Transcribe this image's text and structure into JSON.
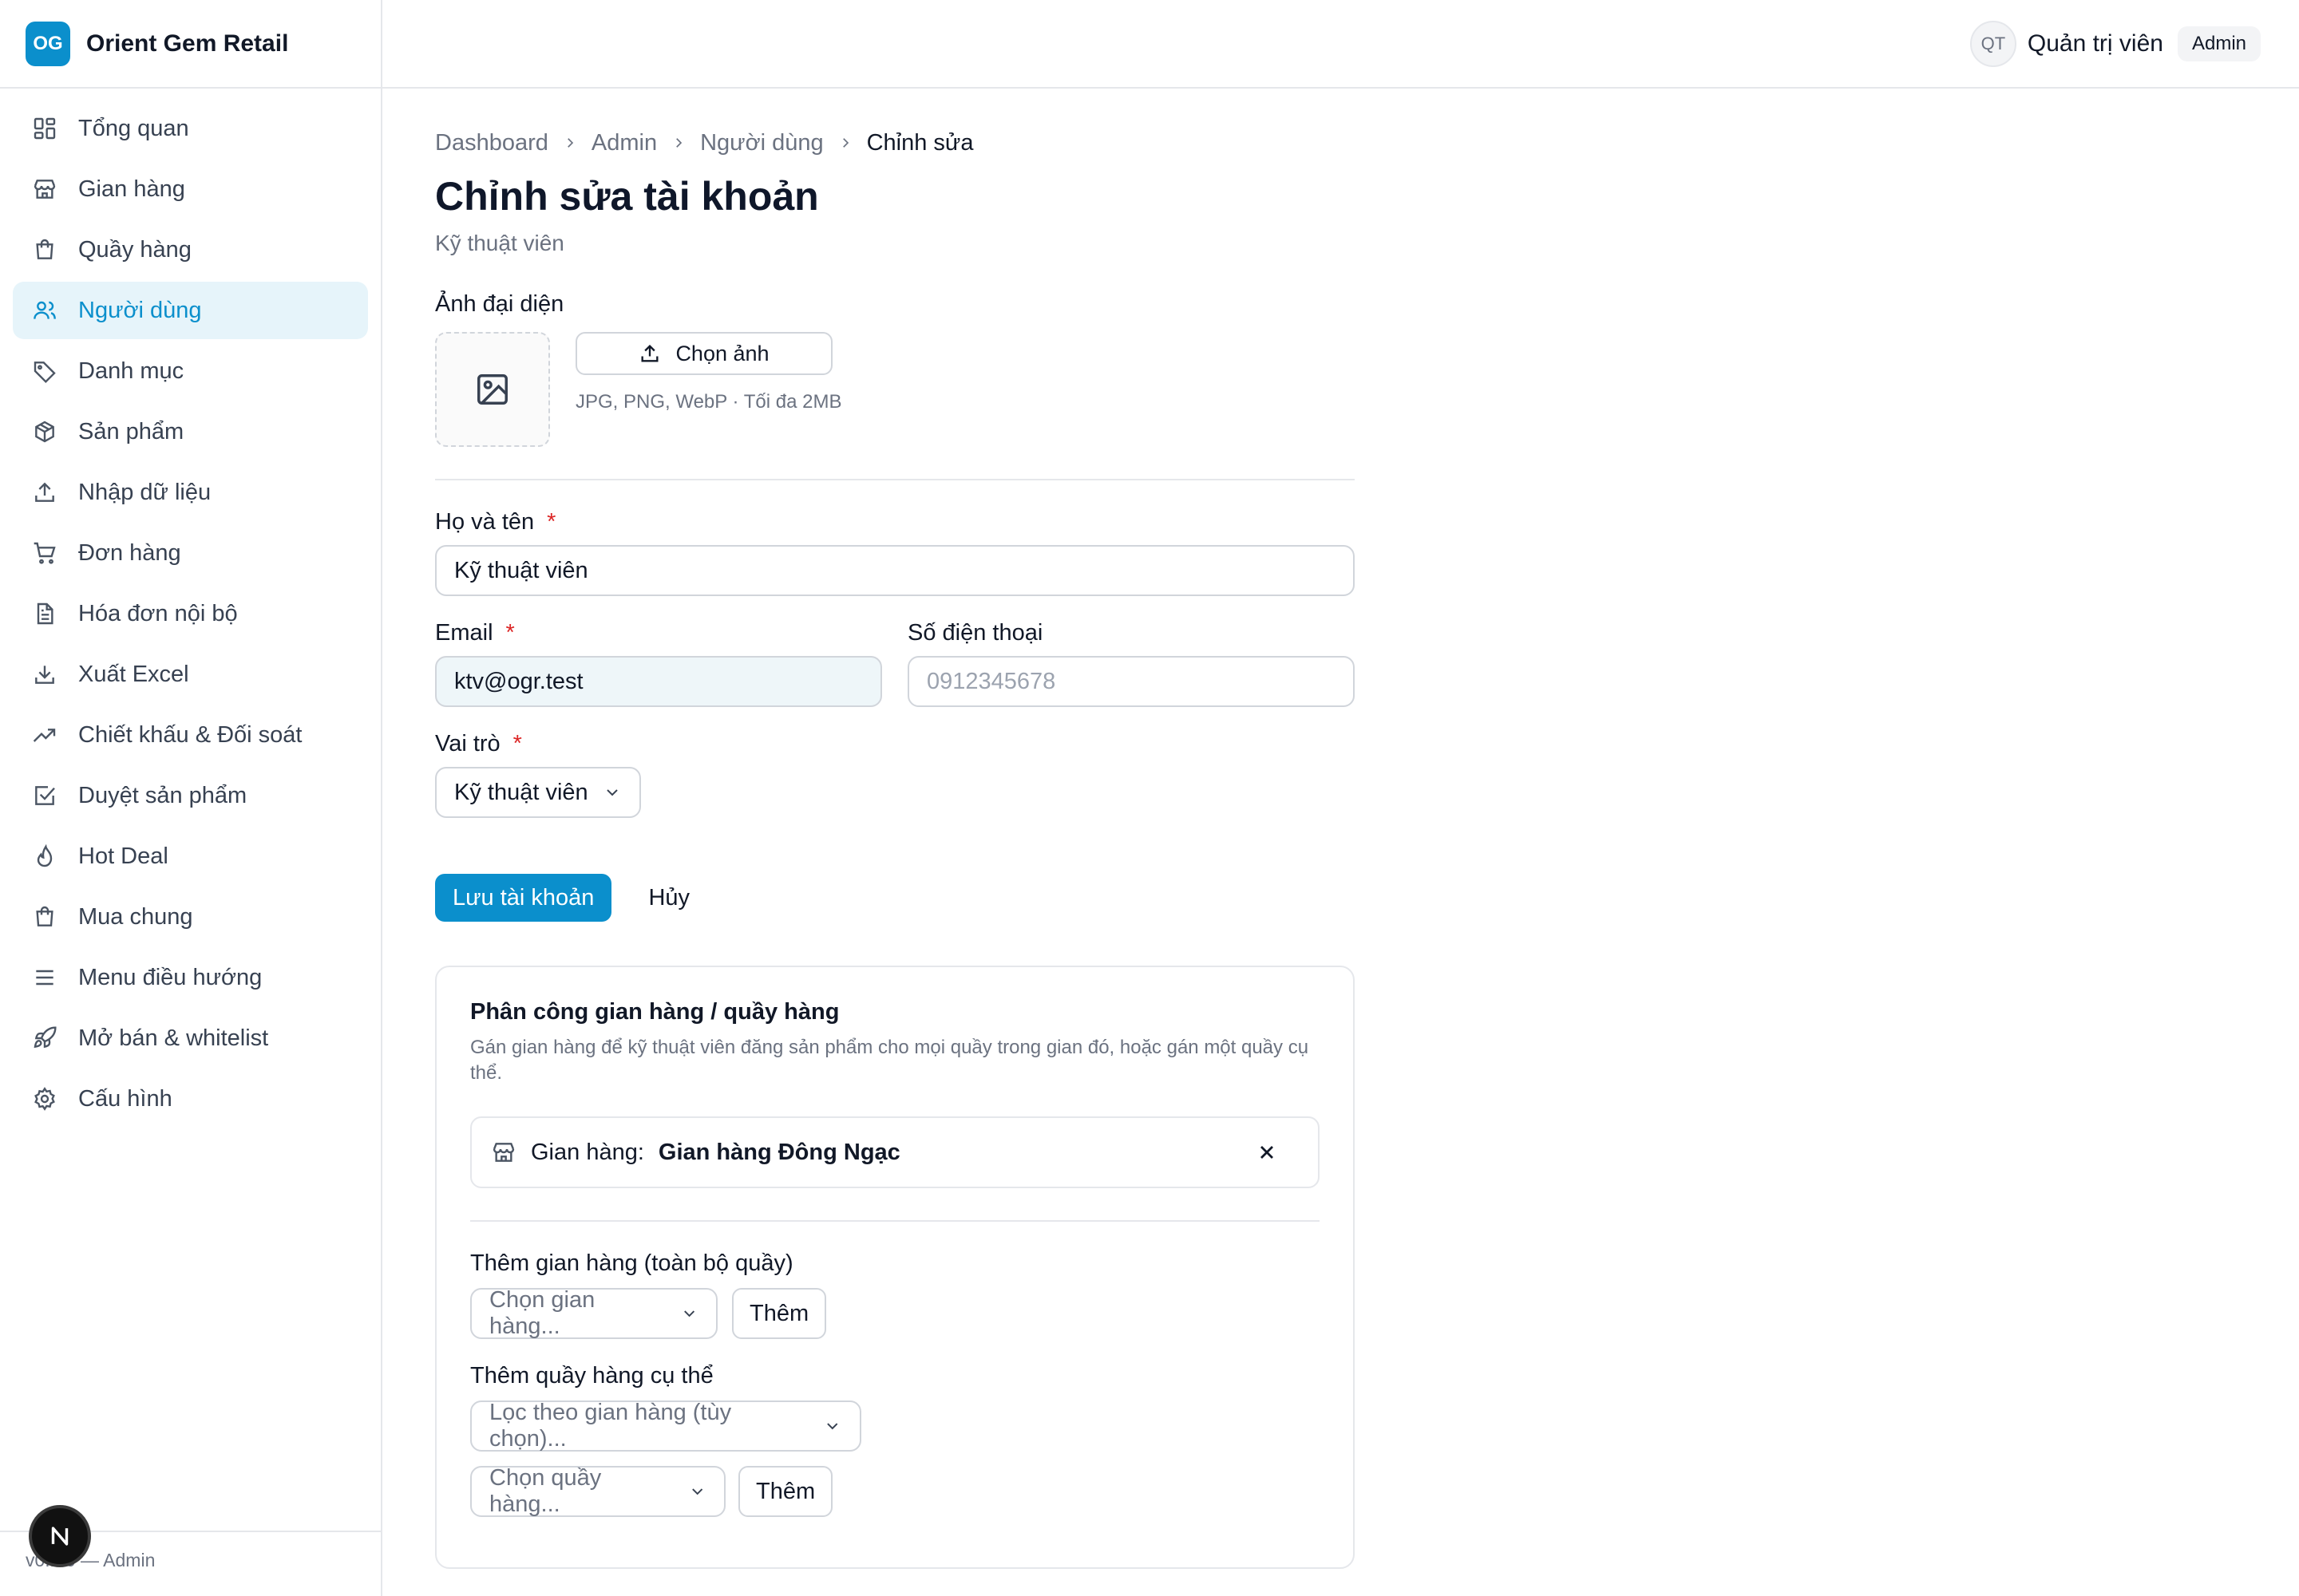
{
  "brand": {
    "logo_text": "OG",
    "name": "Orient Gem Retail"
  },
  "header": {
    "avatar_initials": "QT",
    "user_name": "Quản trị viên",
    "role_badge": "Admin"
  },
  "sidebar": {
    "items": [
      {
        "label": "Tổng quan",
        "icon": "dashboard-icon"
      },
      {
        "label": "Gian hàng",
        "icon": "store-icon"
      },
      {
        "label": "Quầy hàng",
        "icon": "shopping-bag-icon"
      },
      {
        "label": "Người dùng",
        "icon": "users-icon",
        "active": true
      },
      {
        "label": "Danh mục",
        "icon": "tag-icon"
      },
      {
        "label": "Sản phẩm",
        "icon": "package-icon"
      },
      {
        "label": "Nhập dữ liệu",
        "icon": "upload-icon"
      },
      {
        "label": "Đơn hàng",
        "icon": "cart-icon"
      },
      {
        "label": "Hóa đơn nội bộ",
        "icon": "file-text-icon"
      },
      {
        "label": "Xuất Excel",
        "icon": "download-icon"
      },
      {
        "label": "Chiết khấu & Đối soát",
        "icon": "trending-up-icon"
      },
      {
        "label": "Duyệt sản phẩm",
        "icon": "check-square-icon"
      },
      {
        "label": "Hot Deal",
        "icon": "flame-icon"
      },
      {
        "label": "Mua chung",
        "icon": "shopping-bag-icon"
      },
      {
        "label": "Menu điều hướng",
        "icon": "menu-icon"
      },
      {
        "label": "Mở bán & whitelist",
        "icon": "rocket-icon"
      },
      {
        "label": "Cấu hình",
        "icon": "gear-icon"
      }
    ],
    "footer": "v0.1.0 — Admin",
    "next_badge": "N"
  },
  "breadcrumb": [
    "Dashboard",
    "Admin",
    "Người dùng",
    "Chỉnh sửa"
  ],
  "page": {
    "title": "Chỉnh sửa tài khoản",
    "subtitle": "Kỹ thuật viên"
  },
  "avatar_field": {
    "label": "Ảnh đại diện",
    "button": "Chọn ảnh",
    "hint": "JPG, PNG, WebP · Tối đa 2MB"
  },
  "form": {
    "full_name": {
      "label": "Họ và tên",
      "value": "Kỹ thuật viên",
      "required_mark": "*"
    },
    "email": {
      "label": "Email",
      "value": "ktv@ogr.test",
      "required_mark": "*"
    },
    "phone": {
      "label": "Số điện thoại",
      "placeholder": "0912345678"
    },
    "role": {
      "label": "Vai trò",
      "value": "Kỹ thuật viên",
      "required_mark": "*"
    },
    "save_button": "Lưu tài khoản",
    "cancel_button": "Hủy"
  },
  "assignment": {
    "title": "Phân công gian hàng / quầy hàng",
    "description": "Gán gian hàng để kỹ thuật viên đăng sản phẩm cho mọi quầy trong gian đó, hoặc gán một quầy cụ thể.",
    "assigned": {
      "prefix": "Gian hàng:",
      "name": "Gian hàng Đông Ngạc"
    },
    "add_store": {
      "label": "Thêm gian hàng (toàn bộ quầy)",
      "select_placeholder": "Chọn gian hàng...",
      "button": "Thêm"
    },
    "add_counter": {
      "label": "Thêm quầy hàng cụ thể",
      "filter_placeholder": "Lọc theo gian hàng (tùy chọn)...",
      "select_placeholder": "Chọn quầy hàng...",
      "button": "Thêm"
    }
  },
  "colors": {
    "accent": "#0b8fcc",
    "active_bg": "#e6f4fa",
    "required": "#dc2626"
  }
}
